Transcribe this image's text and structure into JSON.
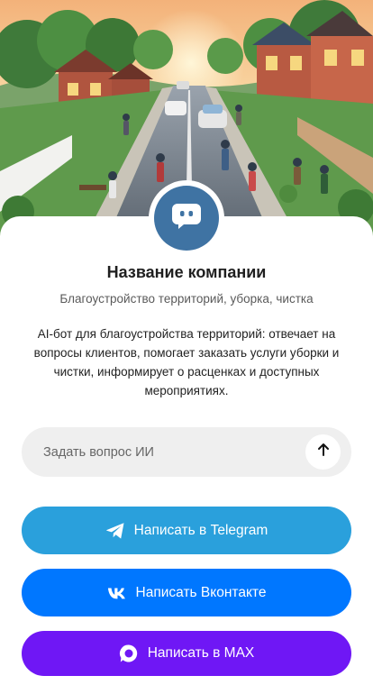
{
  "hero": {
    "image": "street-cleanup-illustration"
  },
  "company": {
    "avatar_icon": "chat-bot-icon",
    "name": "Название компании",
    "tagline": "Благоустройство территорий, уборка, чистка",
    "description": "AI-бот для благоустройства территорий: отвечает на вопросы клиентов, помогает заказать услуги уборки и чистки, информирует о расценках и доступных мероприятиях."
  },
  "ask": {
    "placeholder": "Задать вопрос ИИ",
    "send_icon": "arrow-up-icon"
  },
  "actions": {
    "telegram": {
      "label": "Написать в Telegram",
      "icon": "telegram-icon",
      "color": "#2aa0dc"
    },
    "vk": {
      "label": "Написать Вконтакте",
      "icon": "vk-icon",
      "color": "#0077ff"
    },
    "max": {
      "label": "Написать в MAX",
      "icon": "max-icon",
      "color": "#6f17f5"
    }
  },
  "colors": {
    "avatar": "#3f73a3",
    "input_bg": "#efefef"
  }
}
